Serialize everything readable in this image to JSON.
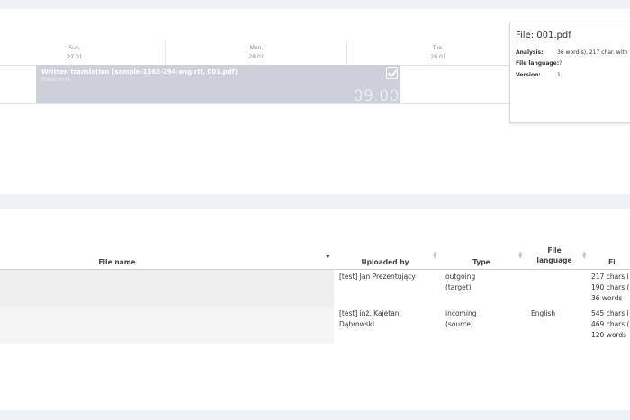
{
  "calendar": {
    "days": [
      {
        "name": "Sun,",
        "date": "27.01"
      },
      {
        "name": "Mon,",
        "date": "28.01"
      },
      {
        "name": "Tue,",
        "date": "29.01"
      }
    ],
    "event": {
      "title": "Written translation (sample-1562-294-ang.rtf, 001.pdf)",
      "status": "Status: done",
      "time": "09:00",
      "color": "#cbd0da"
    }
  },
  "popover": {
    "title": "File: 001.pdf",
    "analysis_label": "Analysis:",
    "analysis_value": "36 word(s), 217 char. with",
    "language_label": "File language:",
    "language_value": "?",
    "version_label": "Version:",
    "version_value": "1"
  },
  "files_table": {
    "headers": {
      "file_name": "File name",
      "uploaded_by": "Uploaded by",
      "type": "Type",
      "file_language_1": "File",
      "file_language_2": "language",
      "file_size": "Fi"
    },
    "rows": [
      {
        "file_name": "",
        "uploaded_by_1": "[test] Jan Prezentujący",
        "uploaded_by_2": "",
        "type_1": "outgoing",
        "type_2": "(target)",
        "language": "",
        "size_1": "217 chars i",
        "size_2": "190 chars (",
        "size_3": "36 words"
      },
      {
        "file_name": "",
        "uploaded_by_1": "[test] inż. Kajetan",
        "uploaded_by_2": "Dąbrowski",
        "type_1": "incoming",
        "type_2": "(source)",
        "language": "English",
        "size_1": "545 chars i",
        "size_2": "469 chars (",
        "size_3": "120 words"
      }
    ]
  }
}
